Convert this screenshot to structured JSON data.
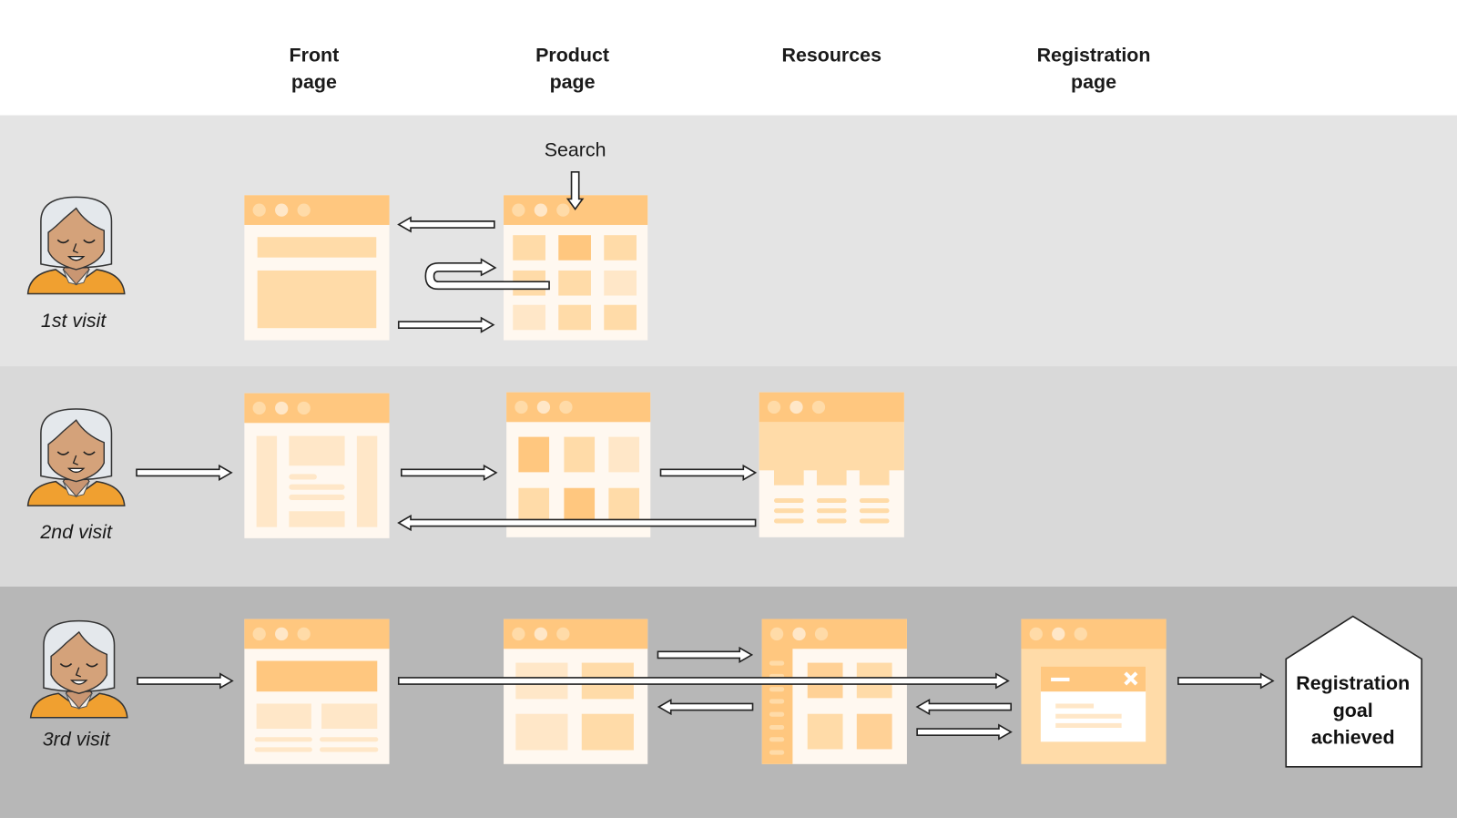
{
  "columns": [
    {
      "id": "front",
      "line1": "Front",
      "line2": "page"
    },
    {
      "id": "product",
      "line1": "Product",
      "line2": "page"
    },
    {
      "id": "resources",
      "line1": "Resources",
      "line2": ""
    },
    {
      "id": "registration",
      "line1": "Registration",
      "line2": "page"
    }
  ],
  "rows": [
    {
      "label": "1st visit",
      "band_color": "#e4e4e4"
    },
    {
      "label": "2nd visit",
      "band_color": "#d9d9d9"
    },
    {
      "label": "3rd visit",
      "band_color": "#b7b7b7"
    }
  ],
  "annotations": {
    "search": "Search"
  },
  "goal": {
    "line1": "Registration",
    "line2": "goal",
    "line3": "achieved"
  },
  "colors": {
    "titlebar": "#ffc77f",
    "page_bg": "#fff8f0",
    "block_light": "#ffe7c8",
    "block_mid": "#ffdba8",
    "block_strong": "#ffc77f",
    "avatar_hair": "#e4e8ec",
    "avatar_skin": "#d4a27a",
    "avatar_shirt": "#f0a030"
  },
  "icons": {
    "avatar": "user-avatar-icon",
    "browser": "browser-window-icon",
    "arrow": "arrow-icon",
    "goal": "house-goal-icon"
  }
}
